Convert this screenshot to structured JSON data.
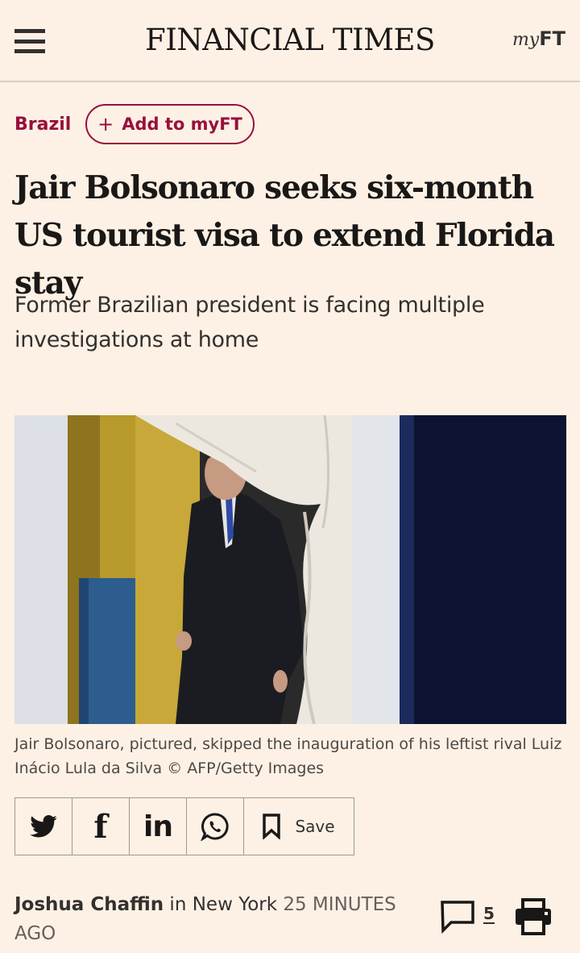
{
  "header": {
    "masthead": "FINANCIAL TIMES",
    "myft_my": "my",
    "myft_ft": "FT"
  },
  "topic": {
    "label": "Brazil",
    "add_button": "Add to myFT"
  },
  "article": {
    "headline": "Jair Bolsonaro seeks six-month US tourist visa to extend Florida stay",
    "standfirst": "Former Brazilian president is facing multiple investigations at home",
    "caption": "Jair Bolsonaro, pictured, skipped the inauguration of his leftist rival Luiz Inácio Lula da Silva © AFP/Getty Images"
  },
  "share": {
    "twitter_icon": "twitter-icon",
    "facebook_label": "f",
    "linkedin_label": "in",
    "whatsapp_icon": "whatsapp-icon",
    "save_label": "Save"
  },
  "byline": {
    "author": "Joshua Chaffin",
    "location_prefix": " in ",
    "location": "New York",
    "time": "25 MINUTES AGO",
    "comment_count": "5"
  },
  "colors": {
    "background": "#fdf1e5",
    "accent": "#990f3d",
    "text": "#33302e"
  }
}
